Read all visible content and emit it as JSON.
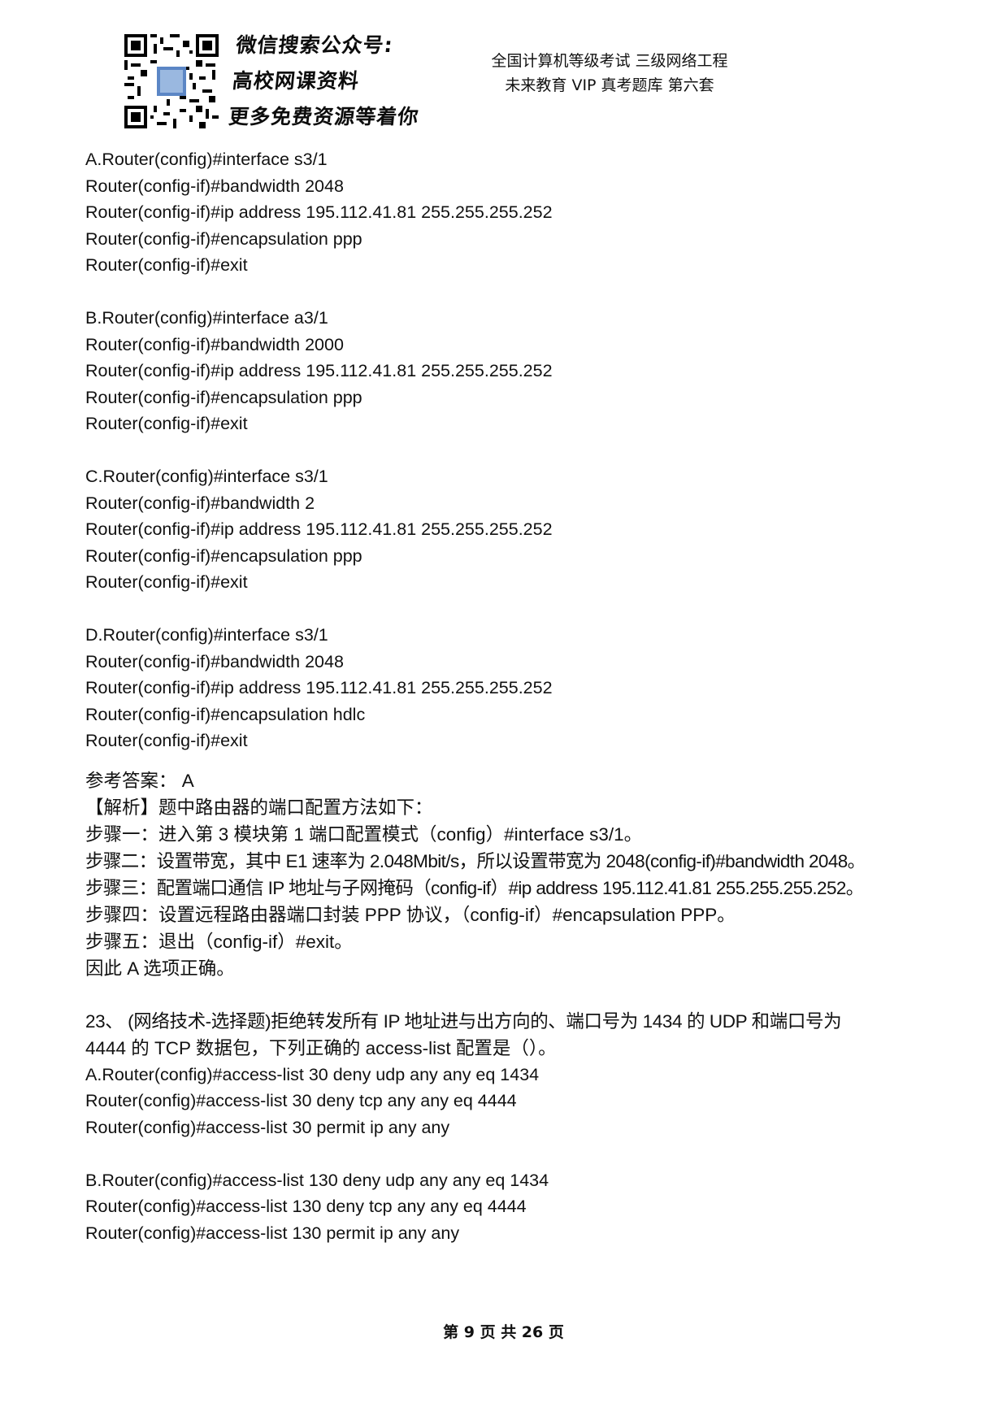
{
  "header": {
    "promo_lines": [
      "微信搜索公众号:",
      "高校网课资料",
      "更多免费资源等着你"
    ],
    "exam_title": "全国计算机等级考试 三级网络工程",
    "exam_subtitle": "未来教育 VIP 真考题库 第六套"
  },
  "options_prev": [
    {
      "lines": [
        "A.Router(config)#interface s3/1",
        "Router(config-if)#bandwidth 2048",
        "Router(config-if)#ip address 195.112.41.81 255.255.255.252",
        "Router(config-if)#encapsulation ppp",
        "Router(config-if)#exit"
      ]
    },
    {
      "lines": [
        "B.Router(config)#interface a3/1",
        "Router(config-if)#bandwidth 2000",
        "Router(config-if)#ip address 195.112.41.81 255.255.255.252",
        "Router(config-if)#encapsulation ppp",
        "Router(config-if)#exit"
      ]
    },
    {
      "lines": [
        "C.Router(config)#interface s3/1",
        "Router(config-if)#bandwidth 2",
        "Router(config-if)#ip address 195.112.41.81 255.255.255.252",
        "Router(config-if)#encapsulation ppp",
        "Router(config-if)#exit"
      ]
    },
    {
      "lines": [
        "D.Router(config)#interface s3/1",
        "Router(config-if)#bandwidth 2048",
        "Router(config-if)#ip address 195.112.41.81 255.255.255.252",
        "Router(config-if)#encapsulation hdlc",
        "Router(config-if)#exit"
      ]
    }
  ],
  "answer": {
    "lines": [
      "参考答案： A",
      "【解析】题中路由器的端口配置方法如下：",
      "步骤一：进入第 3 模块第 1 端口配置模式（config）#interface s3/1。",
      "步骤二：设置带宽，其中 E1 速率为 2.048Mbit/s，所以设置带宽为 2048(config-if)#bandwidth 2048。",
      "步骤三：配置端口通信 IP 地址与子网掩码（config-if）#ip address 195.112.41.81 255.255.255.252。",
      "步骤四：设置远程路由器端口封装 PPP 协议，（config-if）#encapsulation PPP。",
      "步骤五：退出（config-if）#exit。",
      "因此 A 选项正确。"
    ]
  },
  "question23": {
    "text_lines": [
      "23、 (网络技术-选择题)拒绝转发所有 IP 地址进与出方向的、端口号为 1434 的 UDP 和端口号为",
      "4444 的 TCP 数据包，下列正确的 access-list 配置是（）。"
    ],
    "options": [
      {
        "lines": [
          "A.Router(config)#access-list 30 deny udp any any eq 1434",
          "Router(config)#access-list 30 deny tcp any any eq 4444",
          "Router(config)#access-list 30 permit ip any any"
        ]
      },
      {
        "lines": [
          "B.Router(config)#access-list 130 deny udp any any eq 1434",
          "Router(config)#access-list 130 deny tcp any any eq 4444",
          "Router(config)#access-list 130 permit ip any any"
        ]
      }
    ]
  },
  "footer": {
    "page_label": "第 9 页 共 26 页"
  }
}
